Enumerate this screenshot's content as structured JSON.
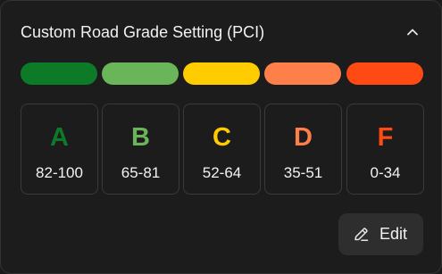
{
  "panel": {
    "title": "Custom Road Grade Setting (PCI)",
    "collapse_icon": "chevron-up-icon"
  },
  "grades": [
    {
      "letter": "A",
      "range": "82-100",
      "color": "#0c7a26"
    },
    {
      "letter": "B",
      "range": "65-81",
      "color": "#6ab45a"
    },
    {
      "letter": "C",
      "range": "52-64",
      "color": "#ffcc00"
    },
    {
      "letter": "D",
      "range": "35-51",
      "color": "#ff7f4a"
    },
    {
      "letter": "F",
      "range": "0-34",
      "color": "#ff4a14"
    }
  ],
  "actions": {
    "edit_label": "Edit",
    "edit_icon": "pencil-icon"
  }
}
